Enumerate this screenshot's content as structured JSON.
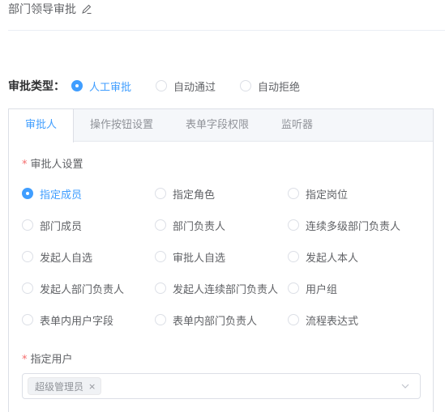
{
  "header": {
    "title": "部门领导审批"
  },
  "approval_type": {
    "label": "审批类型：",
    "options": [
      {
        "label": "人工审批",
        "checked": true
      },
      {
        "label": "自动通过",
        "checked": false
      },
      {
        "label": "自动拒绝",
        "checked": false
      }
    ]
  },
  "tabs": [
    {
      "label": "审批人",
      "active": true
    },
    {
      "label": "操作按钮设置",
      "active": false
    },
    {
      "label": "表单字段权限",
      "active": false
    },
    {
      "label": "监听器",
      "active": false
    }
  ],
  "approver": {
    "required_mark": "*",
    "section_label": "审批人设置",
    "options": [
      {
        "label": "指定成员",
        "checked": true
      },
      {
        "label": "指定角色",
        "checked": false
      },
      {
        "label": "指定岗位",
        "checked": false
      },
      {
        "label": "部门成员",
        "checked": false
      },
      {
        "label": "部门负责人",
        "checked": false
      },
      {
        "label": "连续多级部门负责人",
        "checked": false
      },
      {
        "label": "发起人自选",
        "checked": false
      },
      {
        "label": "审批人自选",
        "checked": false
      },
      {
        "label": "发起人本人",
        "checked": false
      },
      {
        "label": "发起人部门负责人",
        "checked": false
      },
      {
        "label": "发起人连续部门负责人",
        "checked": false
      },
      {
        "label": "用户组",
        "checked": false
      },
      {
        "label": "表单内用户字段",
        "checked": false
      },
      {
        "label": "表单内部门负责人",
        "checked": false
      },
      {
        "label": "流程表达式",
        "checked": false
      }
    ]
  },
  "assign_user": {
    "required_mark": "*",
    "label": "指定用户",
    "tags": [
      {
        "label": "超级管理员",
        "close": "×"
      }
    ]
  },
  "colors": {
    "accent": "#409eff",
    "required": "#f56c6c",
    "border": "#dcdfe6"
  }
}
